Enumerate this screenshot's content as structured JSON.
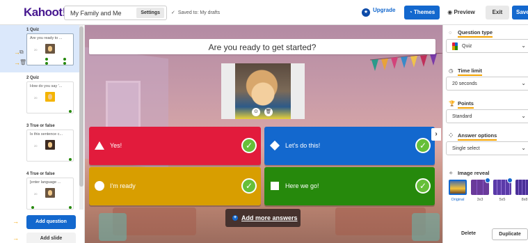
{
  "header": {
    "logo": "Kahoot!",
    "kahoot_title": "My Family and Me",
    "settings_label": "Settings",
    "saved_status": "Saved to: My drafts",
    "upgrade_label": "Upgrade",
    "themes_label": "Themes",
    "preview_label": "Preview",
    "exit_label": "Exit",
    "save_label": "Save"
  },
  "sidebar": {
    "slides": [
      {
        "label": "1 Quiz",
        "question": "Are you ready to ..."
      },
      {
        "label": "2 Quiz",
        "question": "How do you say '..."
      },
      {
        "label": "3 True or false",
        "question": "Is this sentence c..."
      },
      {
        "label": "4 True or false",
        "question": "[enter language ..."
      }
    ],
    "thumb_time": "20",
    "add_question_label": "Add question",
    "add_slide_label": "Add slide"
  },
  "editor": {
    "question": "Are you ready to get started?",
    "answers": [
      {
        "text": "Yes!",
        "shape": "triangle",
        "color": "#e21b3c",
        "correct": true
      },
      {
        "text": "Let's do this!",
        "shape": "diamond",
        "color": "#1368ce",
        "correct": true
      },
      {
        "text": "I'm ready",
        "shape": "circle",
        "color": "#d89e00",
        "correct": true
      },
      {
        "text": "Here we go!",
        "shape": "square",
        "color": "#26890c",
        "correct": true
      }
    ],
    "add_more_label": "Add more answers"
  },
  "panel": {
    "question_type": {
      "heading": "Question type",
      "value": "Quiz"
    },
    "time_limit": {
      "heading": "Time limit",
      "value": "20 seconds"
    },
    "points": {
      "heading": "Points",
      "value": "Standard"
    },
    "answer_options": {
      "heading": "Answer options",
      "value": "Single select"
    },
    "image_reveal": {
      "heading": "Image reveal",
      "options": [
        "Original",
        "3x3",
        "5x5",
        "8x8"
      ],
      "selected": "Original"
    },
    "delete_label": "Delete",
    "duplicate_label": "Duplicate"
  },
  "colors": {
    "brand": "#46178f",
    "accent_blue": "#1368ce",
    "highlight": "#f4a300"
  }
}
